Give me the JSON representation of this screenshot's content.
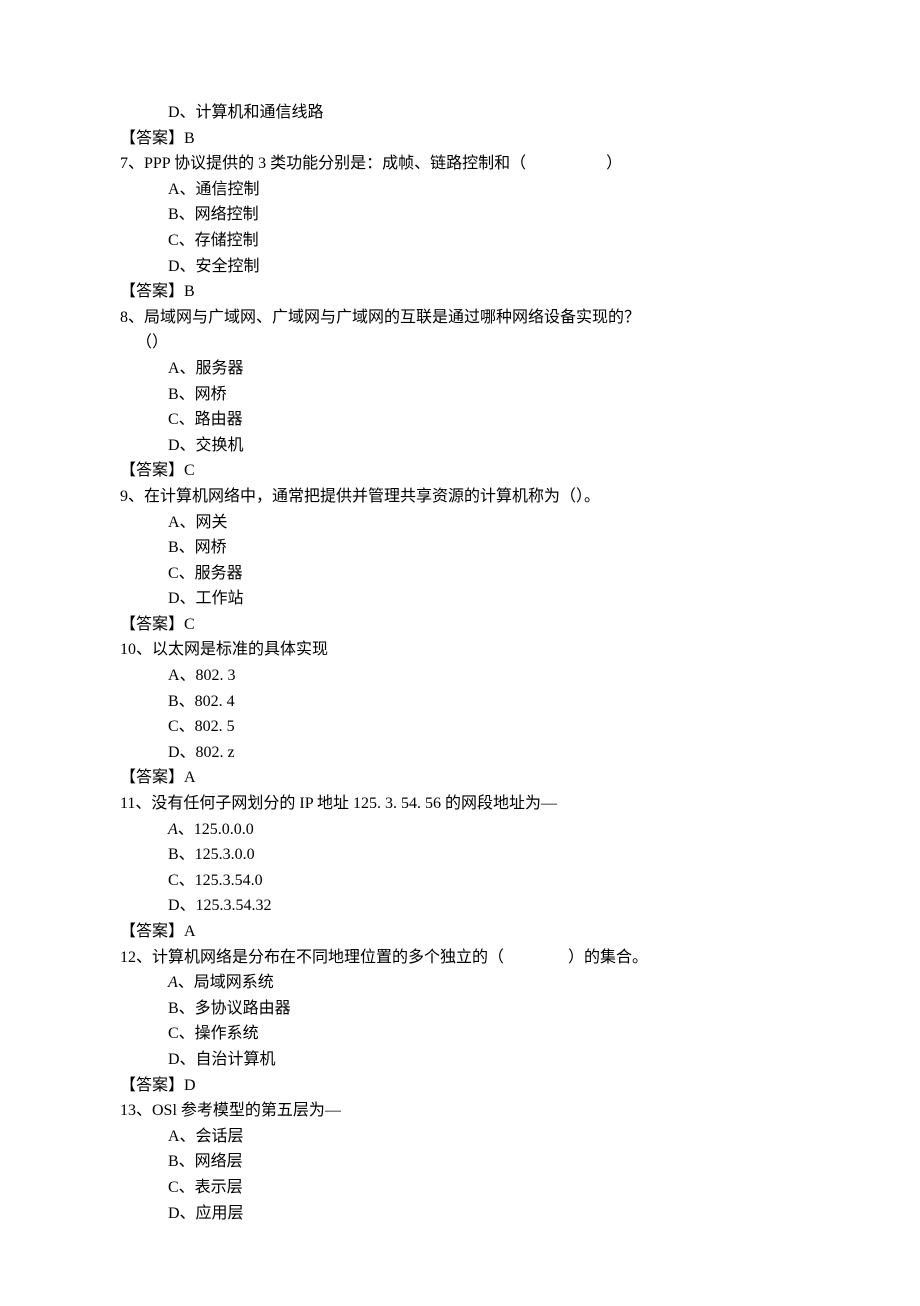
{
  "lines": [
    {
      "cls": "option-line",
      "text": "D、计算机和通信线路"
    },
    {
      "cls": "answer-line",
      "text": "【答案】B"
    },
    {
      "cls": "question-line",
      "text": "7、PPP 协议提供的 3 类功能分别是：成帧、链路控制和（　　　　　）"
    },
    {
      "cls": "option-line",
      "text": "A、通信控制"
    },
    {
      "cls": "option-line",
      "text": "B、网络控制"
    },
    {
      "cls": "option-line",
      "text": "C、存储控制"
    },
    {
      "cls": "option-line",
      "text": "D、安全控制"
    },
    {
      "cls": "answer-line",
      "text": "【答案】B"
    },
    {
      "cls": "question-line",
      "text": "8、局域网与广域网、广域网与广域网的互联是通过哪种网络设备实现的？"
    },
    {
      "cls": "question-cont",
      "text": "（）"
    },
    {
      "cls": "option-line",
      "text": "A、服务器"
    },
    {
      "cls": "option-line",
      "text": "B、网桥"
    },
    {
      "cls": "option-line",
      "text": "C、路由器"
    },
    {
      "cls": "option-line",
      "text": "D、交换机"
    },
    {
      "cls": "answer-line",
      "text": "【答案】C"
    },
    {
      "cls": "question-line",
      "text": "9、在计算机网络中，通常把提供并管理共享资源的计算机称为（）。"
    },
    {
      "cls": "option-line",
      "text": "A、网关"
    },
    {
      "cls": "option-line",
      "text": "B、网桥"
    },
    {
      "cls": "option-line",
      "text": "C、服务器"
    },
    {
      "cls": "option-line",
      "text": "D、工作站"
    },
    {
      "cls": "answer-line",
      "text": "【答案】C"
    },
    {
      "cls": "question-line",
      "text": "10、以太网是标准的具体实现"
    },
    {
      "cls": "option-line",
      "text": "A、802. 3"
    },
    {
      "cls": "option-line",
      "text": "B、802. 4"
    },
    {
      "cls": "option-line",
      "text": "C、802. 5"
    },
    {
      "cls": "option-line",
      "text": "D、802. z"
    },
    {
      "cls": "answer-line",
      "text": "【答案】A"
    },
    {
      "cls": "question-line",
      "text": "11、没有任何子网划分的 IP 地址 125. 3. 54. 56 的网段地址为—"
    },
    {
      "cls": "option-line-italic",
      "label": "A",
      "rest": "、125.0.0.0"
    },
    {
      "cls": "option-line",
      "text": "B、125.3.0.0"
    },
    {
      "cls": "option-line",
      "text": "C、125.3.54.0"
    },
    {
      "cls": "option-line",
      "text": "D、125.3.54.32"
    },
    {
      "cls": "answer-line",
      "text": "【答案】A"
    },
    {
      "cls": "question-line",
      "text": "12、计算机网络是分布在不同地理位置的多个独立的（　　　　）的集合。"
    },
    {
      "cls": "option-line-italic",
      "label": "A",
      "rest": "、局域网系统"
    },
    {
      "cls": "option-line",
      "text": "B、多协议路由器"
    },
    {
      "cls": "option-line",
      "text": "C、操作系统"
    },
    {
      "cls": "option-line",
      "text": "D、自治计算机"
    },
    {
      "cls": "answer-line",
      "text": "【答案】D"
    },
    {
      "cls": "question-line",
      "text": "13、OSl 参考模型的第五层为—"
    },
    {
      "cls": "option-line",
      "text": "A、会话层"
    },
    {
      "cls": "option-line",
      "text": "B、网络层"
    },
    {
      "cls": "option-line",
      "text": "C、表示层"
    },
    {
      "cls": "option-line",
      "text": "D、应用层"
    }
  ]
}
